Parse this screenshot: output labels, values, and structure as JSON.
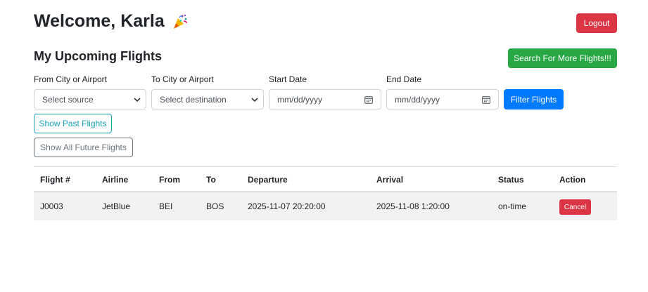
{
  "header": {
    "welcome": "Welcome, Karla",
    "logout_label": "Logout"
  },
  "section": {
    "title": "My Upcoming Flights",
    "search_more_label": "Search For More Flights!!!"
  },
  "filters": {
    "from_label": "From City or Airport",
    "from_value": "Select source",
    "to_label": "To City or Airport",
    "to_value": "Select destination",
    "start_label": "Start Date",
    "start_value": "mm/dd/yyyy",
    "end_label": "End Date",
    "end_value": "mm/dd/yyyy",
    "filter_button": "Filter Flights",
    "past_button": "Show Past Flights",
    "future_button": "Show All Future Flights"
  },
  "table": {
    "columns": [
      "Flight #",
      "Airline",
      "From",
      "To",
      "Departure",
      "Arrival",
      "Status",
      "Action"
    ],
    "rows": [
      {
        "flight": "J0003",
        "airline": "JetBlue",
        "from": "BEI",
        "to": "BOS",
        "departure": "2025-11-07 20:20:00",
        "arrival": "2025-11-08 1:20:00",
        "status": "on-time",
        "action": "Cancel"
      }
    ]
  },
  "colors": {
    "danger": "#dc3545",
    "success": "#28a745",
    "primary": "#007bff",
    "info": "#17a2b8",
    "secondary": "#6c757d"
  },
  "icons": {
    "party": "party-popper-icon",
    "select": "chevron-down-icon",
    "date": "calendar-icon"
  }
}
